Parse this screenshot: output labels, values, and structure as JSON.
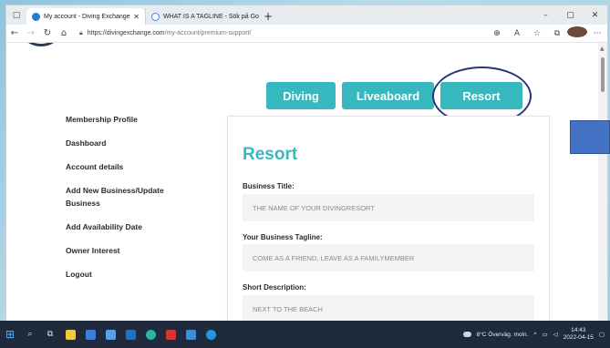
{
  "browser": {
    "tabs": [
      {
        "title": "My account - Diving Exchange",
        "icon_color": "#1f7fd1"
      },
      {
        "title": "WHAT IS A TAGLINE - Sök på Go",
        "icon_color": "#4285f4"
      }
    ],
    "url_host": "https://divingexchange.com",
    "url_path": "/my-account/premium-support/"
  },
  "type_buttons": [
    "Diving",
    "Liveaboard",
    "Resort"
  ],
  "sidebar": {
    "items": [
      "Membership Profile",
      "Dashboard",
      "Account details",
      "Add New Business/Update Business",
      "Add Availability Date",
      "Owner Interest",
      "Logout"
    ]
  },
  "form": {
    "heading": "Resort",
    "fields": [
      {
        "label": "Business Title:",
        "value": "THE NAME OF YOUR DIVINGRESORT"
      },
      {
        "label": "Your Business Tagline:",
        "value": "COME AS A FRIEND, LEAVE AS A FAMILYMEMBER"
      },
      {
        "label": "Short Description:",
        "value": "NEXT TO THE BEACH"
      }
    ]
  },
  "taskbar": {
    "weather": "8°C Överväg. moln.",
    "time": "14:43",
    "date": "2022-04-15"
  },
  "colors": {
    "accent": "#37b8bf",
    "annotation_circle": "#28357a",
    "blue_box": "#4472c4"
  }
}
